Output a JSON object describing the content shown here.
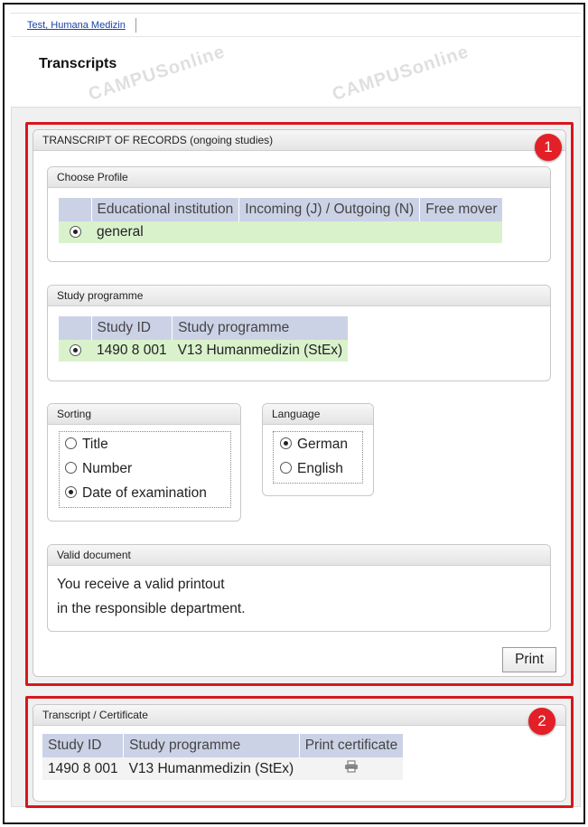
{
  "header": {
    "user_tab": "Test, Humana Medizin",
    "page_title": "Transcripts",
    "watermark_text": "CAMPUSonline"
  },
  "transcript_section": {
    "badge": "1",
    "title": "TRANSCRIPT OF RECORDS (ongoing studies)",
    "choose_profile": {
      "title": "Choose Profile",
      "columns": [
        "Educational institution",
        "Incoming (J) / Outgoing (N)",
        "Free mover"
      ],
      "rows": [
        {
          "label": "general",
          "selected": true
        }
      ]
    },
    "study_programme": {
      "title": "Study programme",
      "columns": [
        "Study ID",
        "Study programme"
      ],
      "rows": [
        {
          "id": "1490 8 001",
          "programme": "V13 Humanmedizin (StEx)",
          "selected": true
        }
      ]
    },
    "sorting": {
      "title": "Sorting",
      "options": [
        {
          "label": "Title",
          "selected": false
        },
        {
          "label": "Number",
          "selected": false
        },
        {
          "label": "Date of examination",
          "selected": true
        }
      ]
    },
    "language": {
      "title": "Language",
      "options": [
        {
          "label": "German",
          "selected": true
        },
        {
          "label": "English",
          "selected": false
        }
      ]
    },
    "valid_document": {
      "title": "Valid document",
      "line1": "You receive a valid printout",
      "line2": "in the responsible department."
    },
    "print_label": "Print"
  },
  "certificate_section": {
    "badge": "2",
    "title": "Transcript / Certificate",
    "columns": [
      "Study ID",
      "Study programme",
      "Print certificate"
    ],
    "rows": [
      {
        "id": "1490 8 001",
        "programme": "V13 Humanmedizin (StEx)",
        "action_icon": "printer-icon"
      }
    ]
  },
  "colors": {
    "highlight": "#d9161c",
    "badge": "#e32027",
    "table_header": "#ccd2e6",
    "selected_row": "#d9f2cc",
    "link": "#1a44a8"
  }
}
